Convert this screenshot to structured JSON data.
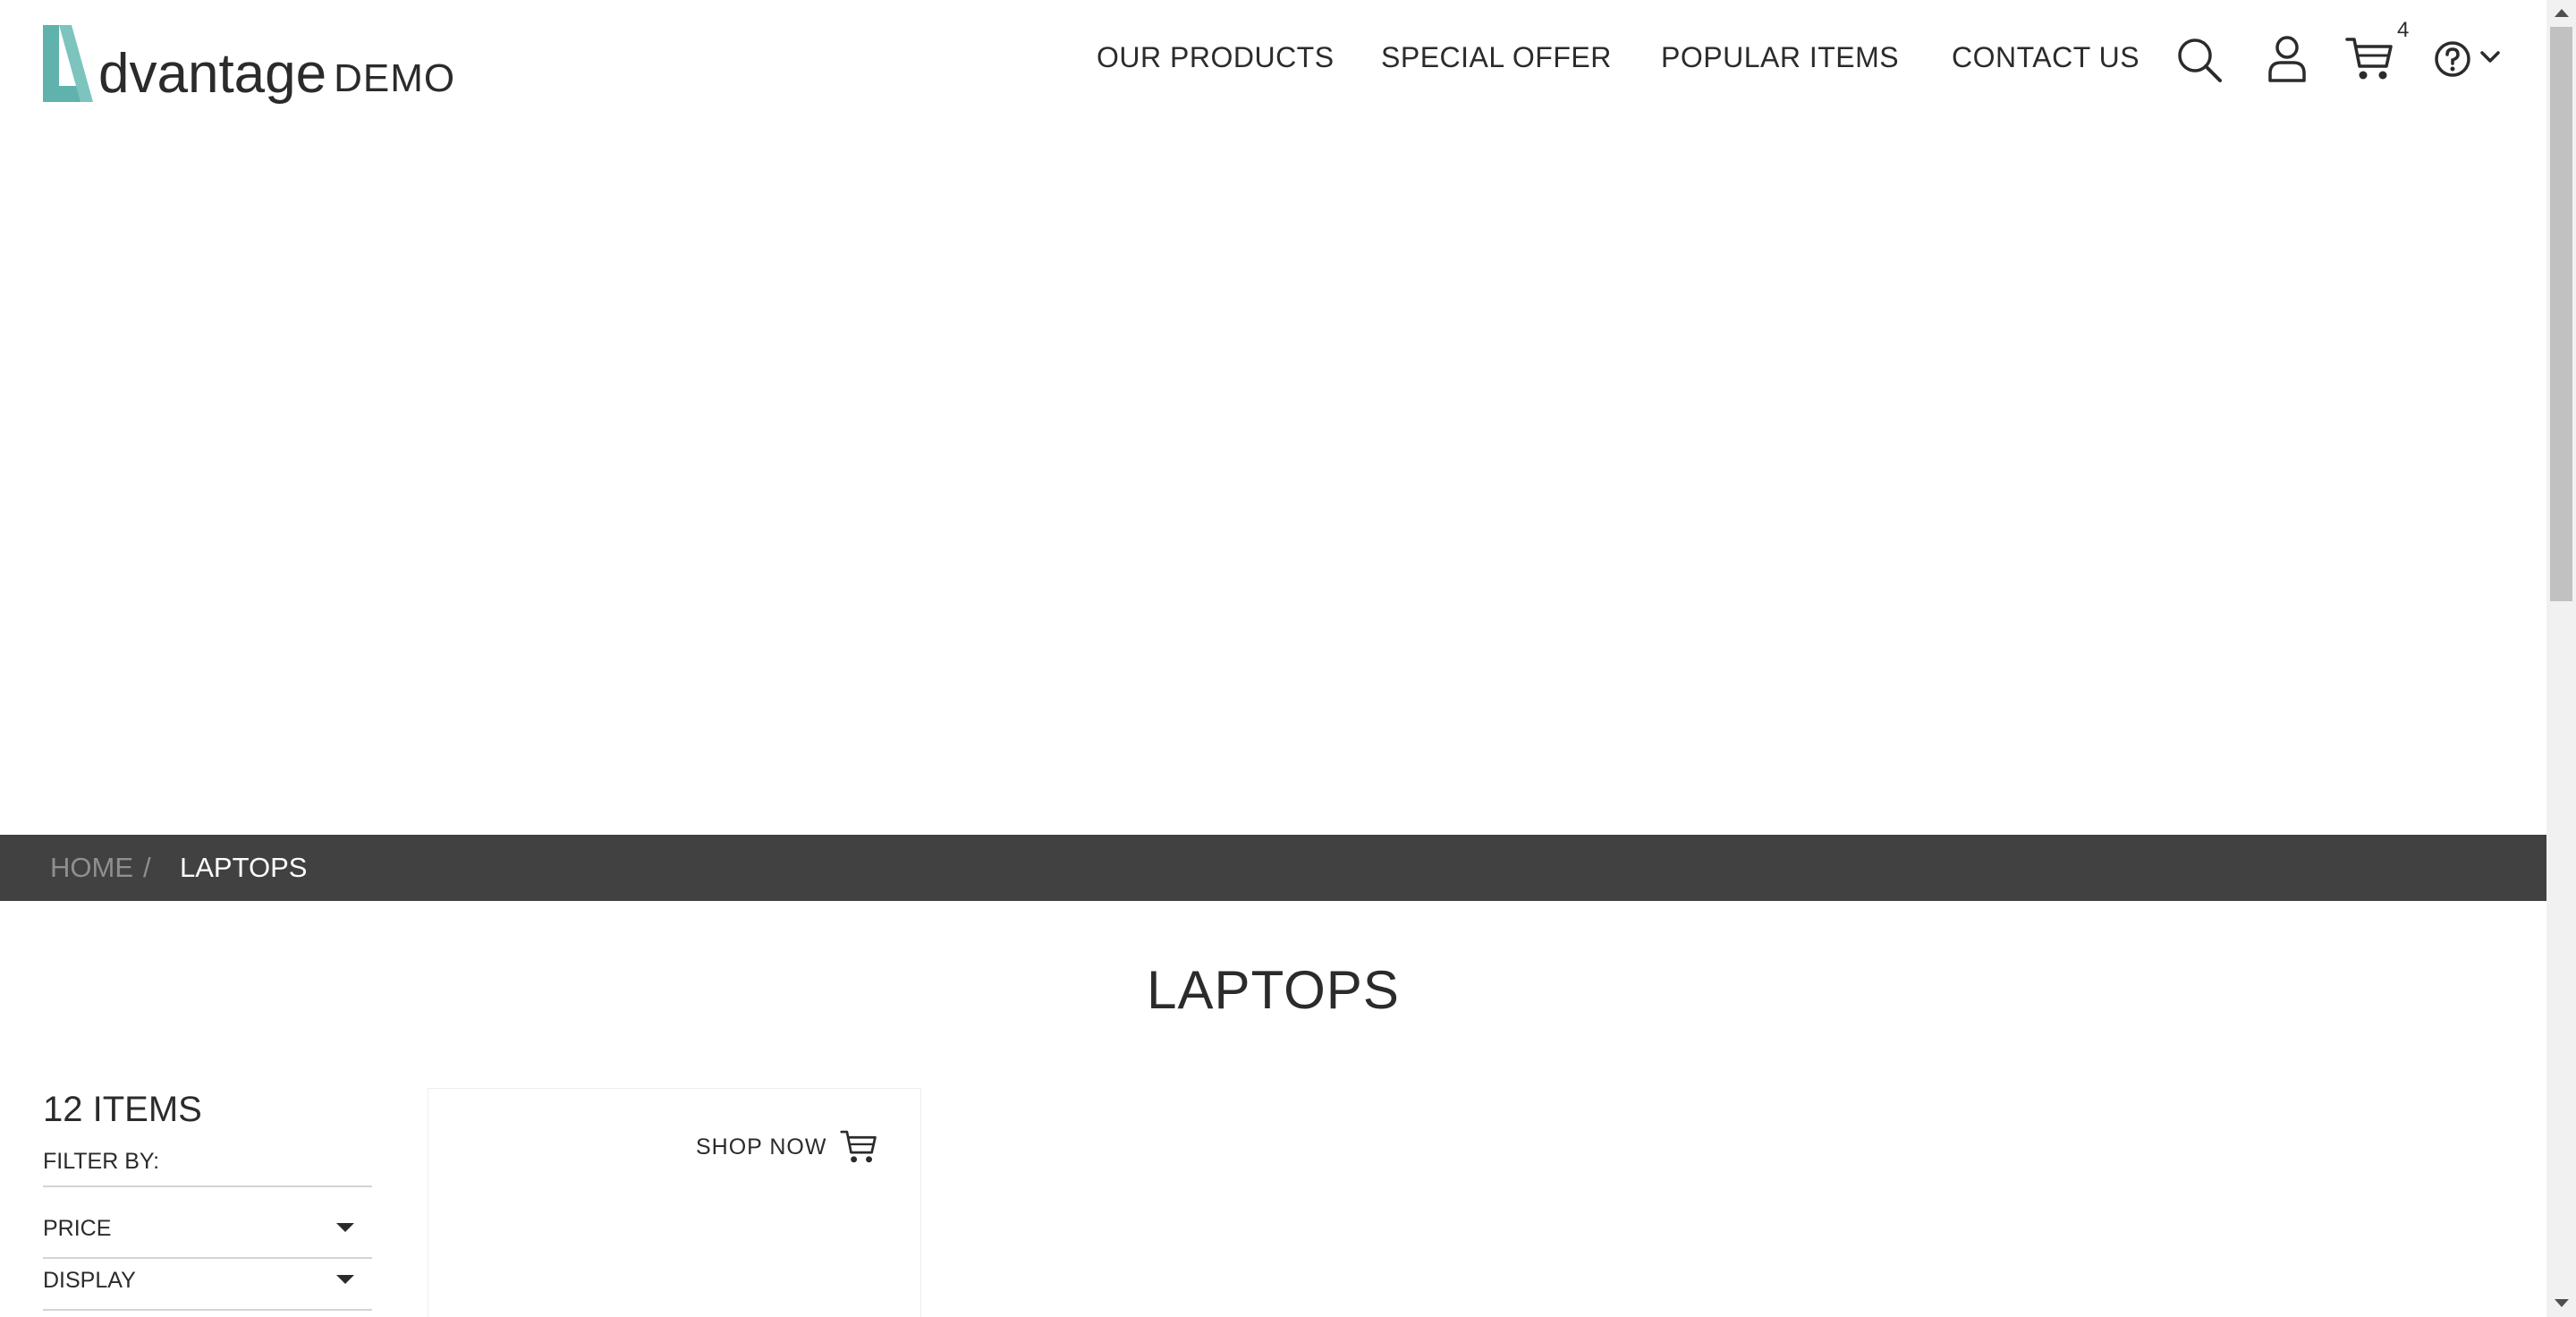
{
  "header": {
    "logo": {
      "word": "dvantage",
      "demo": "DEMO"
    },
    "nav": [
      "OUR PRODUCTS",
      "SPECIAL OFFER",
      "POPULAR ITEMS",
      "CONTACT US"
    ],
    "cart_count": "4",
    "icons": [
      "search-icon",
      "user-icon",
      "cart-icon",
      "help-icon",
      "chevron-down-icon"
    ]
  },
  "breadcrumb": {
    "home": "HOME",
    "separator": "/",
    "current": "LAPTOPS"
  },
  "main": {
    "title": "LAPTOPS",
    "items_count": "12 ITEMS",
    "filter_by": "FILTER BY:",
    "filters": [
      "PRICE",
      "DISPLAY"
    ],
    "product_card": {
      "shop_now": "SHOP NOW"
    }
  },
  "colors": {
    "brand_teal": "#5fb3ac",
    "breadcrumb_bg": "#414141",
    "text": "#2b2b2b"
  }
}
